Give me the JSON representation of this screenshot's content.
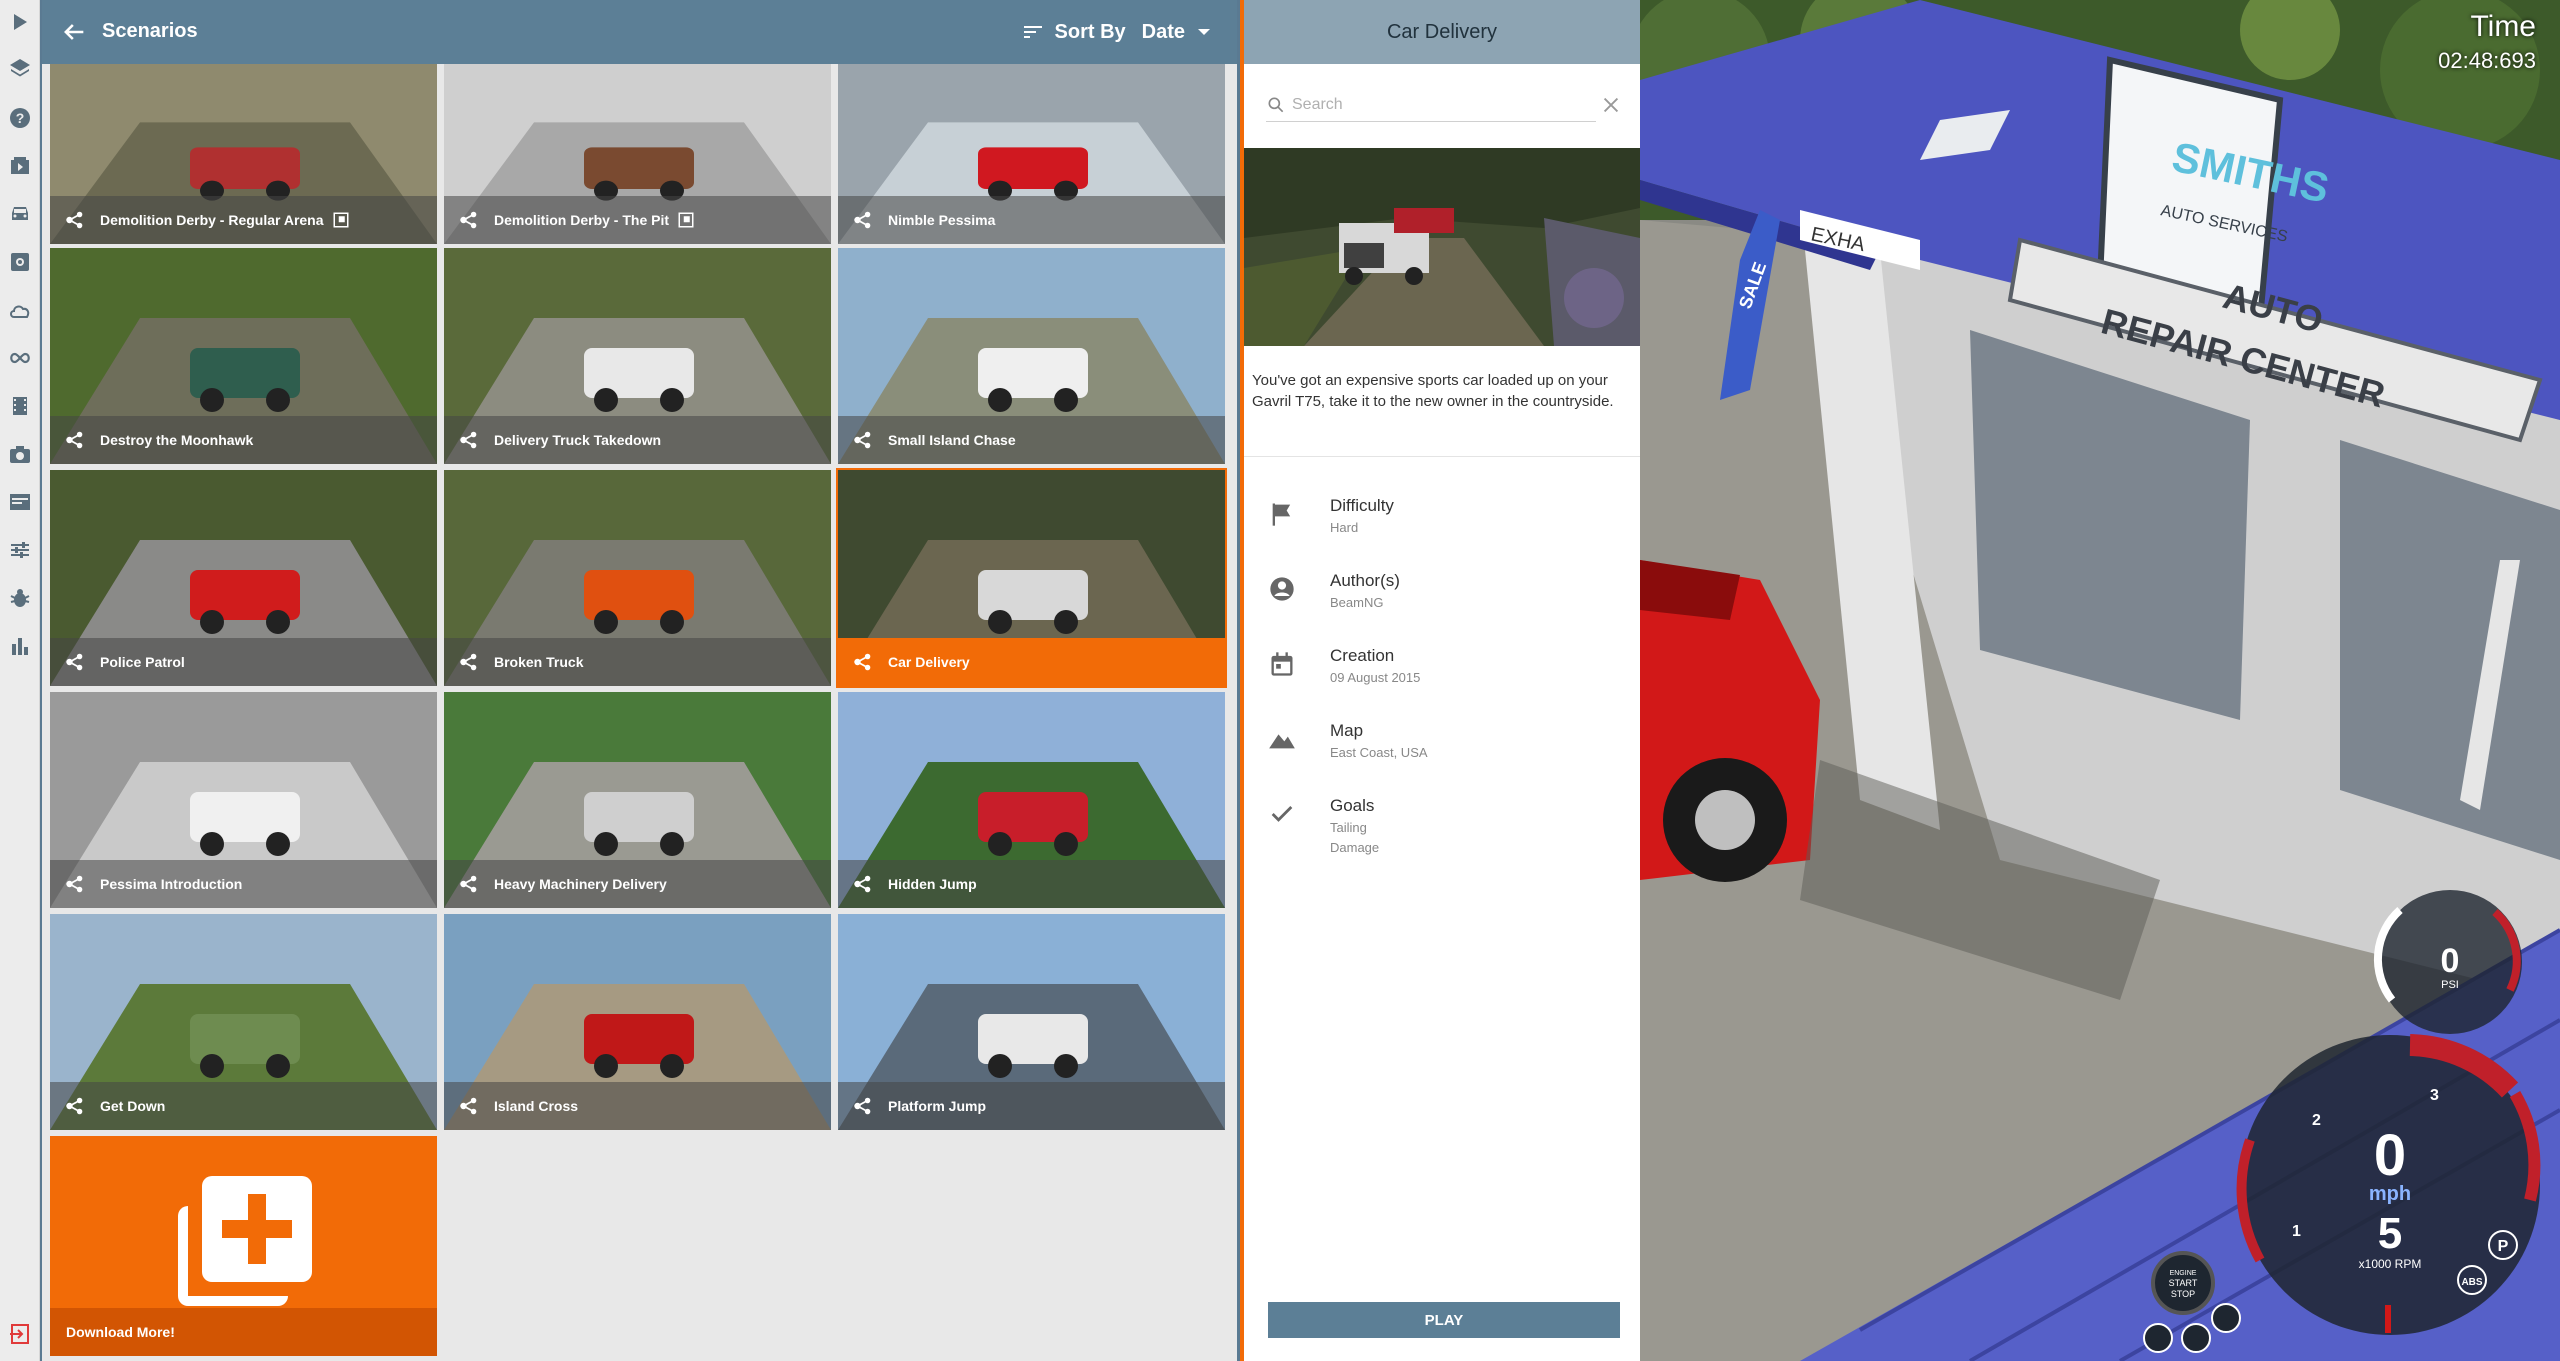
{
  "header": {
    "title": "Scenarios",
    "sort_by_label": "Sort By",
    "sort_value": "Date"
  },
  "scenarios": [
    {
      "name": "Demolition Derby - Regular Arena",
      "has_badge": true
    },
    {
      "name": "Demolition Derby - The Pit",
      "has_badge": true
    },
    {
      "name": "Nimble Pessima",
      "has_badge": false
    },
    {
      "name": "Destroy the Moonhawk",
      "has_badge": false
    },
    {
      "name": "Delivery Truck Takedown",
      "has_badge": false
    },
    {
      "name": "Small Island Chase",
      "has_badge": false
    },
    {
      "name": "Police Patrol",
      "has_badge": false
    },
    {
      "name": "Broken Truck",
      "has_badge": false
    },
    {
      "name": "Car Delivery",
      "has_badge": false,
      "selected": true
    },
    {
      "name": "Pessima Introduction",
      "has_badge": false
    },
    {
      "name": "Heavy Machinery Delivery",
      "has_badge": false
    },
    {
      "name": "Hidden Jump",
      "has_badge": false
    },
    {
      "name": "Get Down",
      "has_badge": false
    },
    {
      "name": "Island Cross",
      "has_badge": false
    },
    {
      "name": "Platform Jump",
      "has_badge": false
    }
  ],
  "download_more": "Download More!",
  "details": {
    "title": "Car Delivery",
    "search_placeholder": "Search",
    "description": "You've got an expensive sports car loaded up on your Gavril T75, take it to the new owner in the countryside.",
    "difficulty_label": "Difficulty",
    "difficulty_value": "Hard",
    "authors_label": "Author(s)",
    "authors_value": "BeamNG",
    "creation_label": "Creation",
    "creation_value": "09 August 2015",
    "map_label": "Map",
    "map_value": "East Coast, USA",
    "goals_label": "Goals",
    "goals_value_1": "Tailing",
    "goals_value_2": "Damage",
    "play_label": "PLAY"
  },
  "hud": {
    "time_label": "Time",
    "time_value": "02:48:693",
    "speed": "0",
    "speed_unit": "mph",
    "gear": "5",
    "rpm_unit": "x1000 RPM",
    "boost": "0",
    "boost_unit": "PSI",
    "engine_line1": "ENGINE",
    "engine_line2": "START",
    "engine_line3": "STOP",
    "sign_line1": "SMITHS",
    "sign_line2": "AUTO SERVICES",
    "sign_line3": "AUTO",
    "sign_line4": "REPAIR CENTER",
    "sale": "SALE",
    "exhaust": "EXHA"
  },
  "colors": {
    "header": "#5c7f96",
    "accent": "#f26b07",
    "detail_header": "#8da4b3"
  }
}
